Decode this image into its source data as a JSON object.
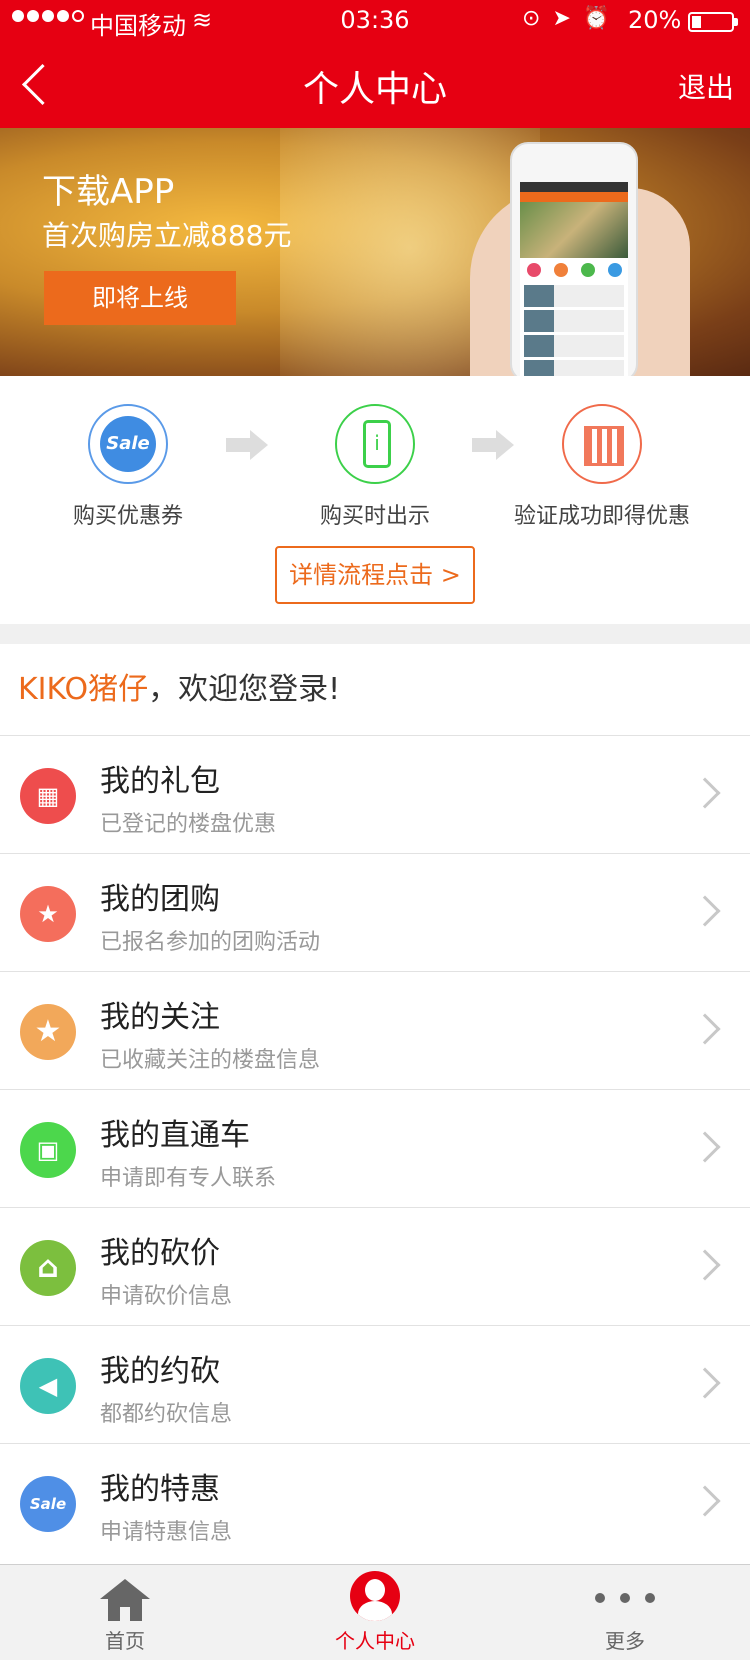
{
  "status_bar": {
    "carrier": "中国移动",
    "time": "03:36",
    "battery": "20%"
  },
  "header": {
    "title": "个人中心",
    "logout": "退出"
  },
  "banner": {
    "line1": "下载APP",
    "line2": "首次购房立减888元",
    "button": "即将上线"
  },
  "steps": {
    "items": [
      {
        "label": "购买优惠券",
        "icon": "sale-coupon-icon"
      },
      {
        "label": "购买时出示",
        "icon": "phone-icon"
      },
      {
        "label": "验证成功即得优惠",
        "icon": "qr-code-icon"
      }
    ],
    "sale_text": "Sale",
    "detail_button": "详情流程点击 >"
  },
  "welcome": {
    "username": "KIKO猪仔",
    "message": "，欢迎您登录!"
  },
  "menu": [
    {
      "title": "我的礼包",
      "subtitle": "已登记的楼盘优惠",
      "icon": "gift-icon",
      "color": "#ee4d4d",
      "glyph": "🎁"
    },
    {
      "title": "我的团购",
      "subtitle": "已报名参加的团购活动",
      "icon": "shopping-bag-icon",
      "color": "#f46e5c",
      "glyph": "★"
    },
    {
      "title": "我的关注",
      "subtitle": "已收藏关注的楼盘信息",
      "icon": "star-icon",
      "color": "#f2a85a",
      "glyph": "★"
    },
    {
      "title": "我的直通车",
      "subtitle": "申请即有专人联系",
      "icon": "bus-icon",
      "color": "#4cd74c",
      "glyph": "▣"
    },
    {
      "title": "我的砍价",
      "subtitle": "申请砍价信息",
      "icon": "house-thumb-icon",
      "color": "#7cbf3e",
      "glyph": "⌂"
    },
    {
      "title": "我的约砍",
      "subtitle": "都都约砍信息",
      "icon": "megaphone-icon",
      "color": "#3ec2b6",
      "glyph": "◀"
    },
    {
      "title": "我的特惠",
      "subtitle": "申请特惠信息",
      "icon": "sale-badge-icon",
      "color": "#4f8fe6",
      "glyph": "Sale"
    }
  ],
  "tabbar": {
    "home": "首页",
    "profile": "个人中心",
    "more": "更多"
  },
  "colors": {
    "brand_red": "#e60012",
    "accent_orange": "#ec6a1c"
  }
}
